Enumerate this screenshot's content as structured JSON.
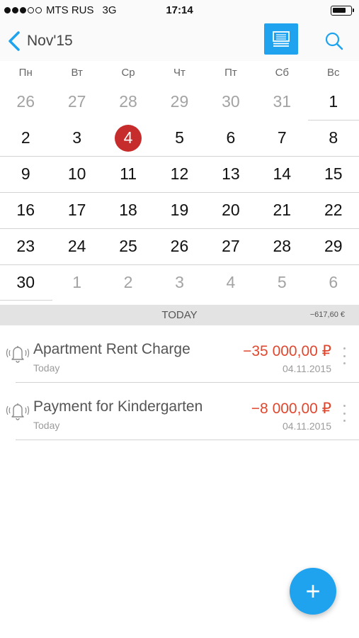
{
  "status_bar": {
    "carrier": "MTS RUS",
    "network": "3G",
    "time": "17:14",
    "signal_bars_filled": 3,
    "signal_bars_total": 5
  },
  "nav": {
    "back_label": "Nov'15",
    "back_icon": "chevron-left-icon",
    "view_icon": "list-view-icon",
    "search_icon": "search-icon",
    "accent_color": "#1fa3ef"
  },
  "calendar": {
    "weekdays": [
      "Пн",
      "Вт",
      "Ср",
      "Чт",
      "Пт",
      "Сб",
      "Вс"
    ],
    "weeks": [
      [
        {
          "d": "26",
          "m": true
        },
        {
          "d": "27",
          "m": true
        },
        {
          "d": "28",
          "m": true
        },
        {
          "d": "29",
          "m": true
        },
        {
          "d": "30",
          "m": true
        },
        {
          "d": "31",
          "m": true
        },
        {
          "d": "1",
          "m": false
        }
      ],
      [
        {
          "d": "2",
          "m": false
        },
        {
          "d": "3",
          "m": false
        },
        {
          "d": "4",
          "m": false,
          "sel": true
        },
        {
          "d": "5",
          "m": false
        },
        {
          "d": "6",
          "m": false
        },
        {
          "d": "7",
          "m": false
        },
        {
          "d": "8",
          "m": false
        }
      ],
      [
        {
          "d": "9",
          "m": false
        },
        {
          "d": "10",
          "m": false
        },
        {
          "d": "11",
          "m": false
        },
        {
          "d": "12",
          "m": false
        },
        {
          "d": "13",
          "m": false
        },
        {
          "d": "14",
          "m": false
        },
        {
          "d": "15",
          "m": false
        }
      ],
      [
        {
          "d": "16",
          "m": false
        },
        {
          "d": "17",
          "m": false
        },
        {
          "d": "18",
          "m": false
        },
        {
          "d": "19",
          "m": false
        },
        {
          "d": "20",
          "m": false
        },
        {
          "d": "21",
          "m": false
        },
        {
          "d": "22",
          "m": false
        }
      ],
      [
        {
          "d": "23",
          "m": false
        },
        {
          "d": "24",
          "m": false
        },
        {
          "d": "25",
          "m": false
        },
        {
          "d": "26",
          "m": false
        },
        {
          "d": "27",
          "m": false
        },
        {
          "d": "28",
          "m": false
        },
        {
          "d": "29",
          "m": false
        }
      ],
      [
        {
          "d": "30",
          "m": false
        },
        {
          "d": "1",
          "m": true
        },
        {
          "d": "2",
          "m": true
        },
        {
          "d": "3",
          "m": true
        },
        {
          "d": "4",
          "m": true
        },
        {
          "d": "5",
          "m": true
        },
        {
          "d": "6",
          "m": true
        }
      ]
    ],
    "selected_color": "#c62c2c"
  },
  "section": {
    "title": "TODAY",
    "total": "−617,60 €"
  },
  "transactions": [
    {
      "title": "Apartment Rent Charge",
      "subtitle": "Today",
      "amount": "−35 000,00 ₽",
      "date": "04.11.2015",
      "icon": "reminder-bell-icon",
      "amount_color": "#e0472f"
    },
    {
      "title": "Payment for Kindergarten",
      "subtitle": "Today",
      "amount": "−8 000,00 ₽",
      "date": "04.11.2015",
      "icon": "reminder-bell-icon",
      "amount_color": "#e0472f"
    }
  ],
  "fab": {
    "label": "+",
    "icon": "plus-icon"
  }
}
